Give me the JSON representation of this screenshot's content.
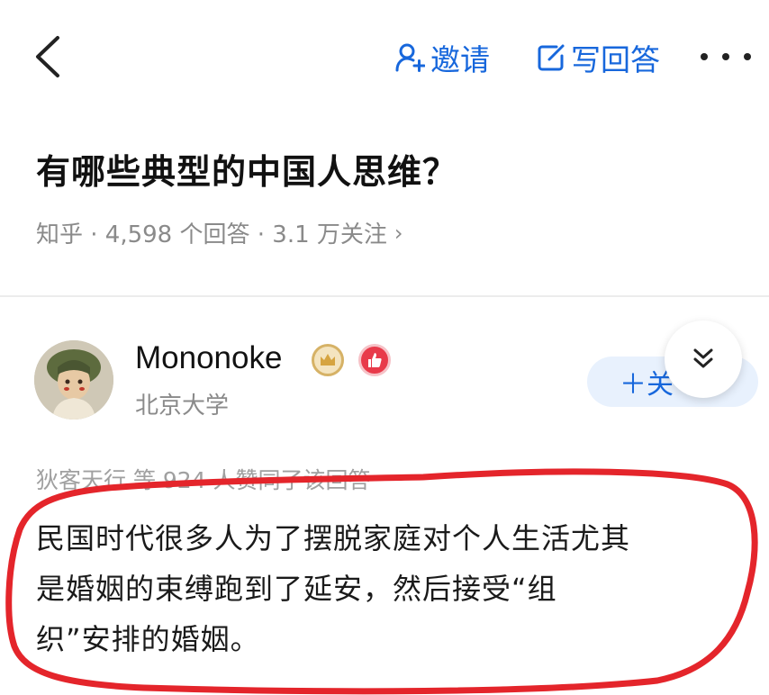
{
  "topbar": {
    "invite_label": "邀请",
    "write_answer_label": "写回答"
  },
  "question": {
    "title": "有哪些典型的中国人思维？",
    "meta": "知乎 · 4,598 个回答 · 3.1 万关注",
    "meta_chevron": "›"
  },
  "author": {
    "name": "Mononoke",
    "school": "北京大学",
    "follow_label": "＋关"
  },
  "answer": {
    "liked_by": "狄客天行 等 924 人赞同了该回答",
    "lines": [
      "民国时代很多人为了摆脱家庭对个人生活尤其",
      "是婚姻的束缚跑到了延安，然后接受“组",
      "织”安排的婚姻。"
    ]
  },
  "colors": {
    "accent": "#1767dc",
    "muted": "#8a8a8a",
    "annotation_red": "#e4252b",
    "follow_bg": "#e8f1fd"
  },
  "icons": [
    "back-arrow-icon",
    "add-user-icon",
    "edit-icon",
    "more-icon",
    "crown-icon",
    "thumbs-up-icon",
    "double-chevron-down-icon"
  ]
}
